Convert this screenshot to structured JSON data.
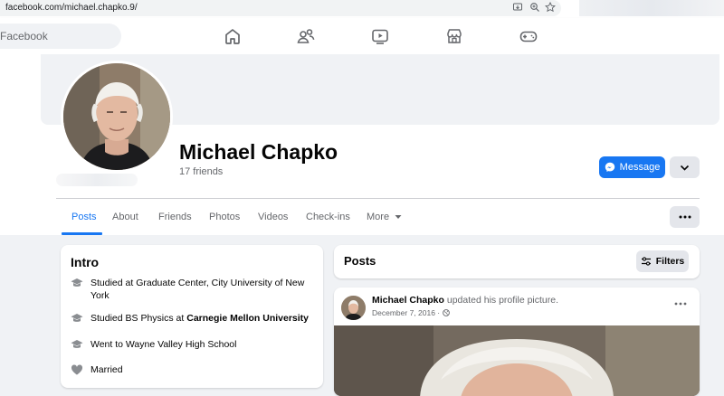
{
  "browser": {
    "url": "facebook.com/michael.chapko.9/"
  },
  "topnav": {
    "search_label": "Facebook",
    "icons": [
      "home-icon",
      "friends-icon",
      "watch-icon",
      "marketplace-icon",
      "gaming-icon"
    ]
  },
  "profile": {
    "name": "Michael Chapko",
    "friends": "17 friends",
    "message_label": "Message"
  },
  "tabs": [
    "Posts",
    "About",
    "Friends",
    "Photos",
    "Videos",
    "Check-ins",
    "More"
  ],
  "intro": {
    "title": "Intro",
    "items": [
      {
        "icon": "graduation-cap-icon",
        "text": "Studied at Graduate Center, City University of New York"
      },
      {
        "icon": "graduation-cap-icon",
        "prefix": "Studied BS Physics at ",
        "bold": "Carnegie Mellon University"
      },
      {
        "icon": "graduation-cap-icon",
        "text": "Went to Wayne Valley High School"
      },
      {
        "icon": "heart-icon",
        "text": "Married"
      }
    ]
  },
  "posts": {
    "title": "Posts",
    "filters_label": "Filters",
    "post": {
      "author": "Michael Chapko",
      "action": " updated his profile picture.",
      "date": "December 7, 2016",
      "separator": " · "
    }
  },
  "colors": {
    "brand": "#1877f2",
    "page_bg": "#f0f2f5",
    "secondary_text": "#65676b"
  }
}
